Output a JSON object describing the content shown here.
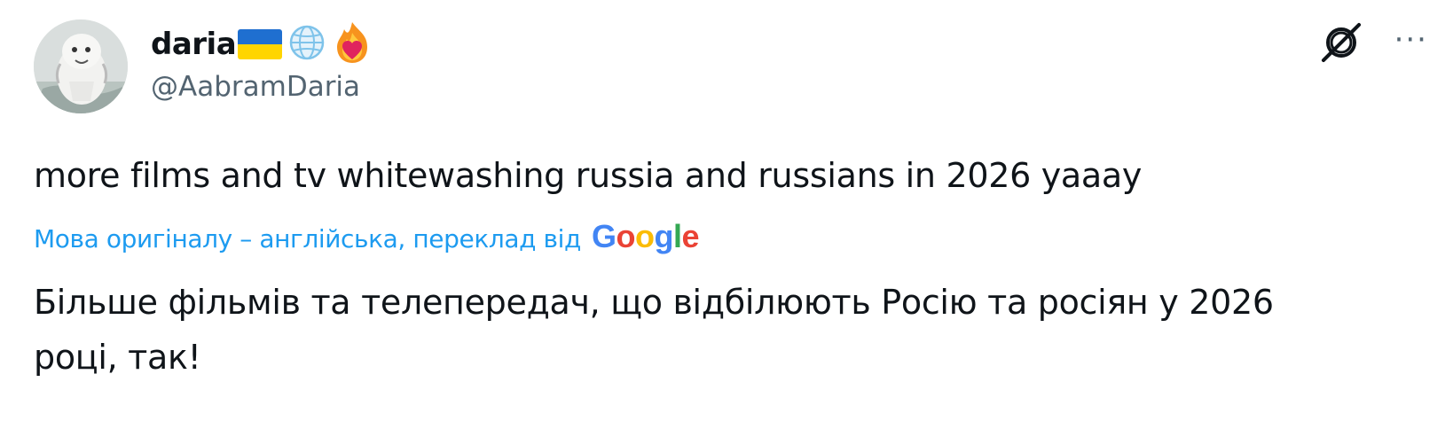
{
  "author": {
    "display_name": "daria",
    "handle": "@AabramDaria",
    "avatar_icon": "avatar-image",
    "badges": [
      "ukraine-flag-icon",
      "globe-icon",
      "fire-heart-icon"
    ]
  },
  "actions": {
    "grok_icon": "grok-icon",
    "more_label": "···"
  },
  "tweet": {
    "text": "more films and tv whitewashing russia and russians in 2026 yaaay",
    "translation_note": "Мова оригіналу – англійська, переклад від",
    "translation_provider": [
      "G",
      "o",
      "o",
      "g",
      "l",
      "e"
    ],
    "translated_text": "Більше фільмів та телепередач, що відбілюють Росію та росіян у 2026 році, так!"
  },
  "colors": {
    "text_primary": "#0f1419",
    "text_secondary": "#536471",
    "link_blue": "#1d9bf0",
    "google_blue": "#4285f4",
    "google_red": "#ea4335",
    "google_yellow": "#fbbc05",
    "google_green": "#34a853"
  }
}
